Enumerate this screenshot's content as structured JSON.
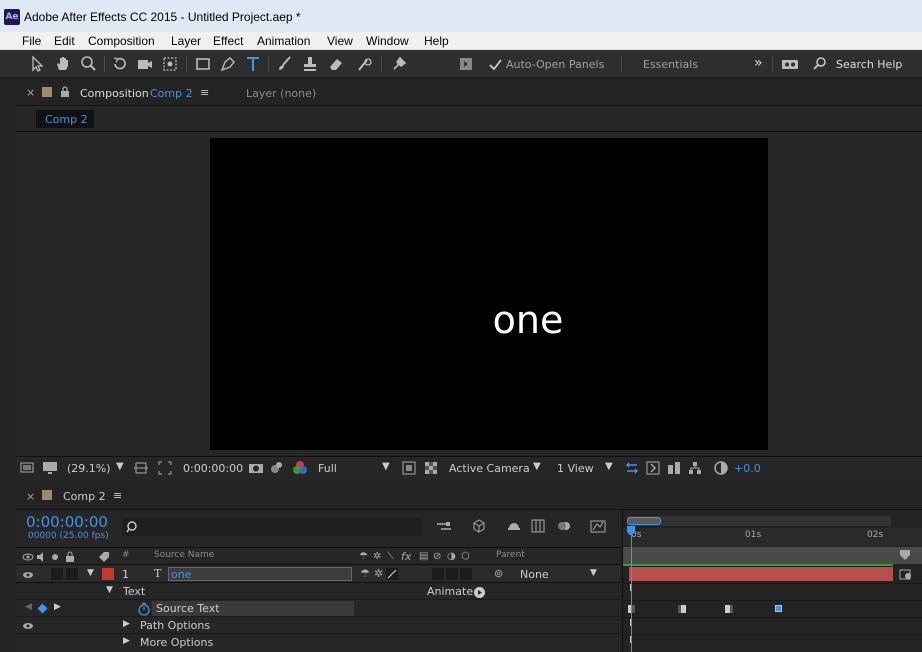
{
  "window": {
    "title": "Adobe After Effects CC 2015 - Untitled Project.aep *",
    "logo": "Ae"
  },
  "menu": [
    "File",
    "Edit",
    "Composition",
    "Layer",
    "Effect",
    "Animation",
    "View",
    "Window",
    "Help"
  ],
  "toolbar": {
    "auto_open_label": "Auto-Open Panels",
    "auto_open_checked": true,
    "workspace": "Essentials",
    "search_label": "Search Help",
    "tools": [
      "selection-tool-icon",
      "hand-tool-icon",
      "zoom-tool-icon",
      "rotation-tool-icon",
      "camera-tool-icon",
      "pan-behind-tool-icon",
      "rectangle-tool-icon",
      "pen-tool-icon",
      "type-tool-icon",
      "brush-tool-icon",
      "clone-stamp-tool-icon",
      "eraser-tool-icon",
      "roto-brush-tool-icon",
      "puppet-tool-icon"
    ]
  },
  "composition_panel": {
    "tab_prefix": "Composition",
    "tab_comp": "Comp 2",
    "layer_tab": "Layer (none)",
    "subtab": "Comp 2",
    "canvas_text": "one",
    "footer": {
      "zoom": "(29.1%)",
      "timecode": "0:00:00:00",
      "resolution": "Full",
      "camera": "Active Camera",
      "views": "1 View",
      "exposure": "+0.0"
    }
  },
  "timeline": {
    "tab": "Comp 2",
    "timecode": "0:00:00:00",
    "frames": "00000 (25.00 fps)",
    "search_placeholder": "",
    "ruler": {
      "start": "0s",
      "mid": "01s",
      "end": "02s"
    },
    "header": {
      "hash": "#",
      "source_name": "Source Name",
      "parent": "Parent"
    },
    "layer": {
      "number": "1",
      "name": "one",
      "parent": "None",
      "color": "#c8372d"
    },
    "rows": {
      "text": "Text",
      "animate": "Animate:",
      "source_text": "Source Text",
      "path_options": "Path Options",
      "more_options": "More Options"
    }
  },
  "colors": {
    "accent": "#3f95e6",
    "layer_bar": "#b84f4a",
    "work_area": "#2e9e3e"
  }
}
